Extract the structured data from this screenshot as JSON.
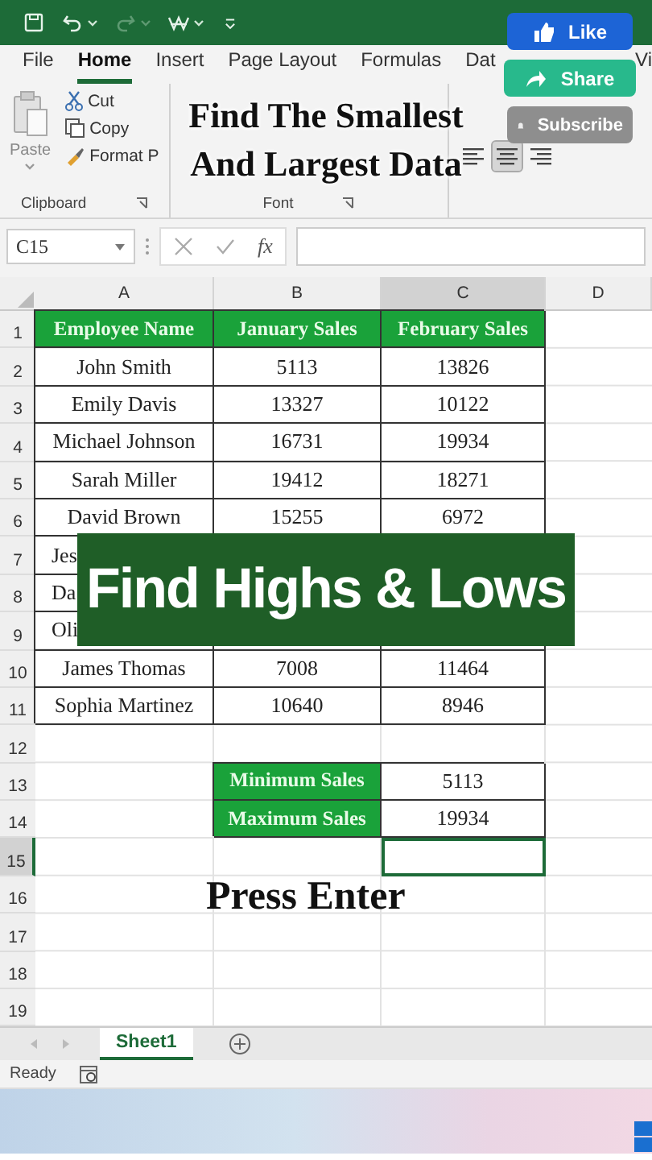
{
  "ribbon_tabs": [
    {
      "label": "File",
      "selected": false
    },
    {
      "label": "Home",
      "selected": true
    },
    {
      "label": "Insert",
      "selected": false
    },
    {
      "label": "Page Layout",
      "selected": false
    },
    {
      "label": "Formulas",
      "selected": false
    },
    {
      "label": "Dat",
      "selected": false
    },
    {
      "label": "Vi",
      "selected": false
    }
  ],
  "clipboard": {
    "paste": "Paste",
    "cut": "Cut",
    "copy": "Copy",
    "format_painter": "Format P",
    "group_label": "Clipboard"
  },
  "font_group": {
    "group_label": "Font"
  },
  "alignment": [
    {
      "selected": false
    },
    {
      "selected": true
    },
    {
      "selected": false
    }
  ],
  "formula_bar": {
    "name_box": "C15",
    "function_label": "fx"
  },
  "columns": [
    {
      "label": "A",
      "selected": false
    },
    {
      "label": "B",
      "selected": false
    },
    {
      "label": "C",
      "selected": true
    },
    {
      "label": "D",
      "selected": false
    }
  ],
  "rows": [
    {
      "number": "1",
      "selected": false,
      "cells": [
        {
          "kind": "header",
          "text": "Employee Name"
        },
        {
          "kind": "header",
          "text": "January Sales"
        },
        {
          "kind": "header",
          "text": "February Sales"
        }
      ]
    },
    {
      "number": "2",
      "selected": false,
      "cells": [
        {
          "kind": "value",
          "text": "John Smith"
        },
        {
          "kind": "value",
          "text": "5113"
        },
        {
          "kind": "value",
          "text": "13826"
        }
      ]
    },
    {
      "number": "3",
      "selected": false,
      "cells": [
        {
          "kind": "value",
          "text": "Emily Davis"
        },
        {
          "kind": "value",
          "text": "13327"
        },
        {
          "kind": "value",
          "text": "10122"
        }
      ]
    },
    {
      "number": "4",
      "selected": false,
      "cells": [
        {
          "kind": "value",
          "text": "Michael Johnson"
        },
        {
          "kind": "value",
          "text": "16731"
        },
        {
          "kind": "value",
          "text": "19934"
        }
      ]
    },
    {
      "number": "5",
      "selected": false,
      "cells": [
        {
          "kind": "value",
          "text": "Sarah Miller"
        },
        {
          "kind": "value",
          "text": "19412"
        },
        {
          "kind": "value",
          "text": "18271"
        }
      ]
    },
    {
      "number": "6",
      "selected": false,
      "cells": [
        {
          "kind": "value",
          "text": "David Brown"
        },
        {
          "kind": "value",
          "text": "15255"
        },
        {
          "kind": "value",
          "text": "6972"
        }
      ]
    },
    {
      "number": "7",
      "selected": false,
      "cells": [
        {
          "kind": "partial",
          "text": "Jes"
        },
        {
          "kind": "covered"
        },
        {
          "kind": "covered"
        }
      ]
    },
    {
      "number": "8",
      "selected": false,
      "cells": [
        {
          "kind": "partial",
          "text": "Da"
        },
        {
          "kind": "covered"
        },
        {
          "kind": "covered"
        }
      ]
    },
    {
      "number": "9",
      "selected": false,
      "cells": [
        {
          "kind": "partial",
          "text": "Oli"
        },
        {
          "kind": "value"
        },
        {
          "kind": "value"
        }
      ]
    },
    {
      "number": "10",
      "selected": false,
      "cells": [
        {
          "kind": "value",
          "text": "James Thomas"
        },
        {
          "kind": "value",
          "text": "7008"
        },
        {
          "kind": "value",
          "text": "11464"
        }
      ]
    },
    {
      "number": "11",
      "selected": false,
      "cells": [
        {
          "kind": "value",
          "text": "Sophia Martinez"
        },
        {
          "kind": "value",
          "text": "10640"
        },
        {
          "kind": "value",
          "text": "8946"
        }
      ]
    },
    {
      "number": "12",
      "selected": false,
      "cells": []
    },
    {
      "number": "13",
      "selected": false,
      "cells": [
        {
          "kind": "blank"
        },
        {
          "kind": "header",
          "text": "Minimum Sales"
        },
        {
          "kind": "value",
          "text": "5113"
        }
      ]
    },
    {
      "number": "14",
      "selected": false,
      "cells": [
        {
          "kind": "blank"
        },
        {
          "kind": "header",
          "text": "Maximum Sales"
        },
        {
          "kind": "value",
          "text": "19934"
        }
      ]
    },
    {
      "number": "15",
      "selected": true,
      "cells": []
    },
    {
      "number": "16",
      "selected": false,
      "cells": []
    },
    {
      "number": "17",
      "selected": false,
      "cells": []
    },
    {
      "number": "18",
      "selected": false,
      "cells": []
    },
    {
      "number": "19",
      "selected": false,
      "cells": []
    }
  ],
  "sheet_tabs": [
    {
      "label": "Sheet1",
      "selected": true
    }
  ],
  "status_bar": {
    "text": "Ready"
  },
  "overlays": {
    "headline": [
      "Find The Smallest",
      "And Largest Data"
    ],
    "banner": "Find Highs & Lows",
    "caption": "Press Enter",
    "social_buttons": [
      {
        "kind": "like",
        "label": "Like"
      },
      {
        "kind": "share",
        "label": "Share"
      },
      {
        "kind": "subscribe",
        "label": "Subscribe"
      }
    ]
  }
}
